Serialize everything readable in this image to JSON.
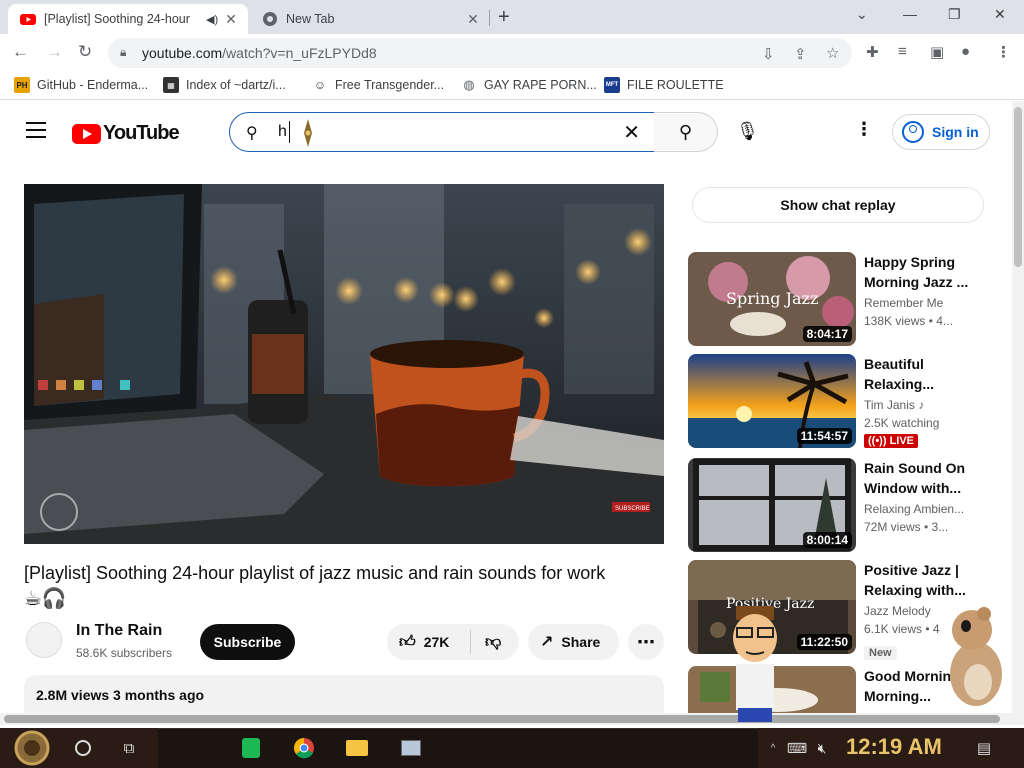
{
  "tabs": [
    {
      "title": "[Playlist] Soothing 24-hour",
      "active": true,
      "icon": "youtube-icon"
    },
    {
      "title": "New Tab",
      "active": false,
      "icon": "chrome-icon"
    }
  ],
  "omnibox": {
    "url_host": "youtube.com",
    "url_path": "/watch?v=n_uFzLPYDd8"
  },
  "bookmarks": [
    {
      "label": "GitHub - Enderma...",
      "icon": "PH"
    },
    {
      "label": "Index of ~dartz/i...",
      "icon": "grid"
    },
    {
      "label": "Free Transgender...",
      "icon": "mask"
    },
    {
      "label": "GAY RAPE PORN...",
      "icon": "globe"
    },
    {
      "label": "FILE ROULETTE",
      "icon": "MFT"
    }
  ],
  "header": {
    "logo_text": "YouTube",
    "search_value": "h",
    "signin_label": "Sign in"
  },
  "video": {
    "title": "[Playlist] Soothing 24-hour playlist of jazz music and rain sounds for work",
    "emojis": "☕🎧",
    "channel": "In The Rain",
    "subscribers": "58.6K subscribers",
    "subscribe_label": "Subscribe",
    "likes": "27K",
    "share_label": "Share",
    "views": "2.8M views",
    "age": "3 months ago",
    "overlay_subscribe": "SUBSCRIBE"
  },
  "sidebar": {
    "chat_replay_label": "Show chat replay",
    "recs": [
      {
        "title": "Happy Spring Morning Jazz ...",
        "channel": "Remember Me",
        "meta": "138K views  • 4...",
        "duration": "8:04:17",
        "thumb_text": "Spring Jazz"
      },
      {
        "title": "Beautiful Relaxing...",
        "channel": "Tim Janis",
        "meta": "2.5K watching",
        "duration": "11:54:57",
        "badge": "LIVE"
      },
      {
        "title": "Rain Sound On Window with...",
        "channel": "Relaxing Ambien...",
        "meta": "72M views  • 3...",
        "duration": "8:00:14"
      },
      {
        "title": "Positive Jazz | Relaxing with...",
        "channel": "Jazz Melody",
        "meta": "6.1K views  • 4",
        "duration": "11:22:50",
        "badge": "New",
        "thumb_text": "Positive Jazz"
      },
      {
        "title": "Good Mornin | Morning...",
        "channel": "",
        "meta": "",
        "duration": ""
      }
    ]
  },
  "taskbar": {
    "time": "12:19 AM"
  },
  "colors": {
    "youtube_red": "#ff0000",
    "link_blue": "#065fd4",
    "live_red": "#cc0000"
  }
}
